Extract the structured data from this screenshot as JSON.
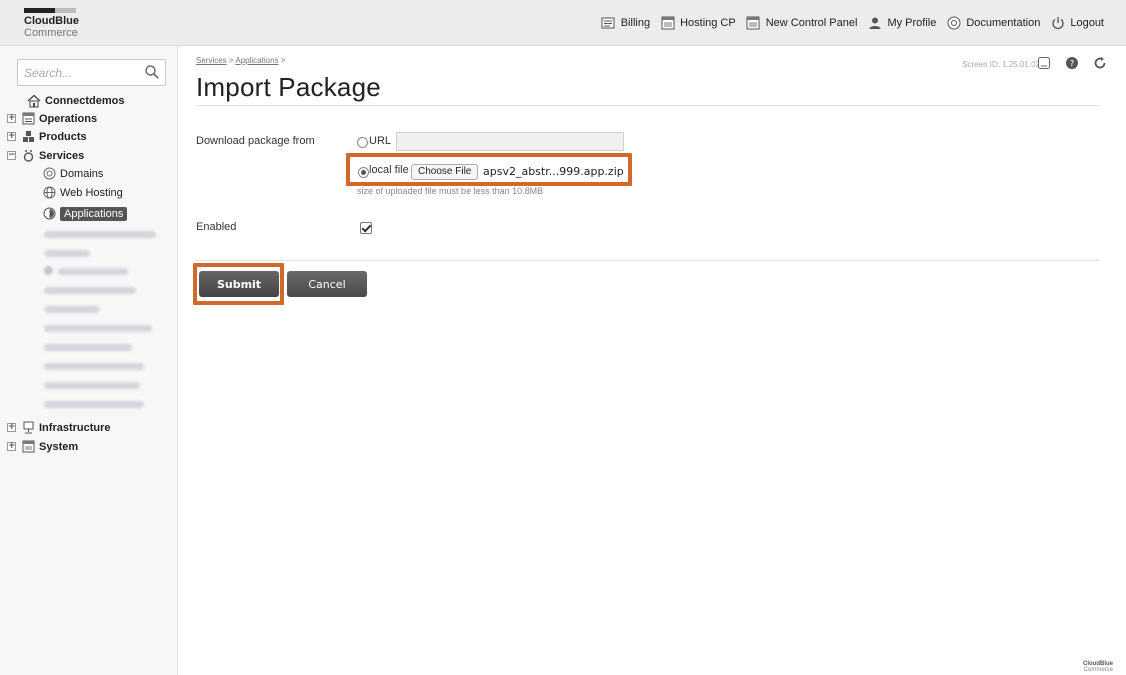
{
  "brand": {
    "name": "CloudBlue",
    "sub": "Commerce"
  },
  "topnav": [
    {
      "label": "Billing",
      "icon": "billing-icon"
    },
    {
      "label": "Hosting CP",
      "icon": "hosting-cp-icon"
    },
    {
      "label": "New Control Panel",
      "icon": "control-panel-icon"
    },
    {
      "label": "My Profile",
      "icon": "profile-icon"
    },
    {
      "label": "Documentation",
      "icon": "documentation-icon"
    },
    {
      "label": "Logout",
      "icon": "logout-icon"
    }
  ],
  "sidebar": {
    "search_placeholder": "Search...",
    "root": "Connectdemos",
    "items": [
      {
        "label": "Operations",
        "expander": "+"
      },
      {
        "label": "Products",
        "expander": "+"
      },
      {
        "label": "Services",
        "expander": "−"
      },
      {
        "label": "Infrastructure",
        "expander": "+"
      },
      {
        "label": "System",
        "expander": "+"
      }
    ],
    "services_children": [
      {
        "label": "Domains"
      },
      {
        "label": "Web Hosting"
      },
      {
        "label": "Applications",
        "selected": true
      }
    ]
  },
  "main": {
    "breadcrumb": [
      "Services",
      "Applications"
    ],
    "breadcrumb_sep": ">",
    "title": "Import Package",
    "screen_id": "Screen ID: 1.25.01.02",
    "form": {
      "download_label": "Download package from",
      "url_option": "URL",
      "url_value": "",
      "local_option": "local file",
      "choose_file": "Choose File",
      "file_name": "apsv2_abstr...999.app.zip",
      "hint": "size of uploaded file must be less than 10.8MB",
      "enabled_label": "Enabled",
      "enabled": true
    },
    "buttons": {
      "submit": "Submit",
      "cancel": "Cancel"
    }
  },
  "footer": {
    "name": "CloudBlue",
    "sub": "Commerce"
  },
  "colors": {
    "highlight": "#cf6a2c",
    "button": "#555555",
    "topbar": "#ececec"
  }
}
